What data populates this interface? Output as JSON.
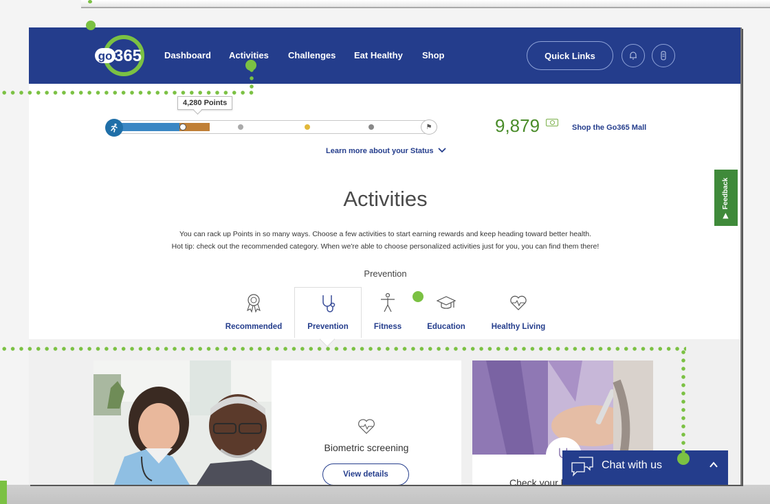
{
  "nav": {
    "links": [
      "Dashboard",
      "Activities",
      "Challenges",
      "Eat Healthy",
      "Shop"
    ],
    "quick_links": "Quick Links",
    "logo_text": "go365"
  },
  "status": {
    "points_tooltip": "4,280 Points",
    "total_points": "9,879",
    "shop_mall": "Shop the Go365 Mall",
    "learn_more": "Learn more about your Status",
    "progress_fraction": 0.31
  },
  "feedback": "Feedback",
  "main": {
    "title": "Activities",
    "intro_line1": "You can rack up Points in so many ways. Choose a few activities to start earning rewards and keep heading toward better health.",
    "intro_line2": "Hot tip: check out the recommended category. When we're able to choose personalized activities just for you, you can find them there!",
    "category_heading": "Prevention",
    "tabs": [
      {
        "label": "Recommended",
        "icon": "award-ribbon-icon"
      },
      {
        "label": "Prevention",
        "icon": "stethoscope-icon",
        "active": true
      },
      {
        "label": "Fitness",
        "icon": "person-figure-icon"
      },
      {
        "label": "Education",
        "icon": "graduation-cap-icon"
      },
      {
        "label": "Healthy Living",
        "icon": "heart-pulse-icon"
      }
    ]
  },
  "cards": [
    {
      "title": "Biometric screening",
      "button": "View details",
      "icon": "heart-pulse-icon"
    },
    {
      "title": "Check your b",
      "icon": "stethoscope-icon"
    }
  ],
  "chat": {
    "label": "Chat with us"
  },
  "colors": {
    "navy": "#243d8c",
    "green": "#7bc143",
    "points_green": "#4a8c2a"
  }
}
